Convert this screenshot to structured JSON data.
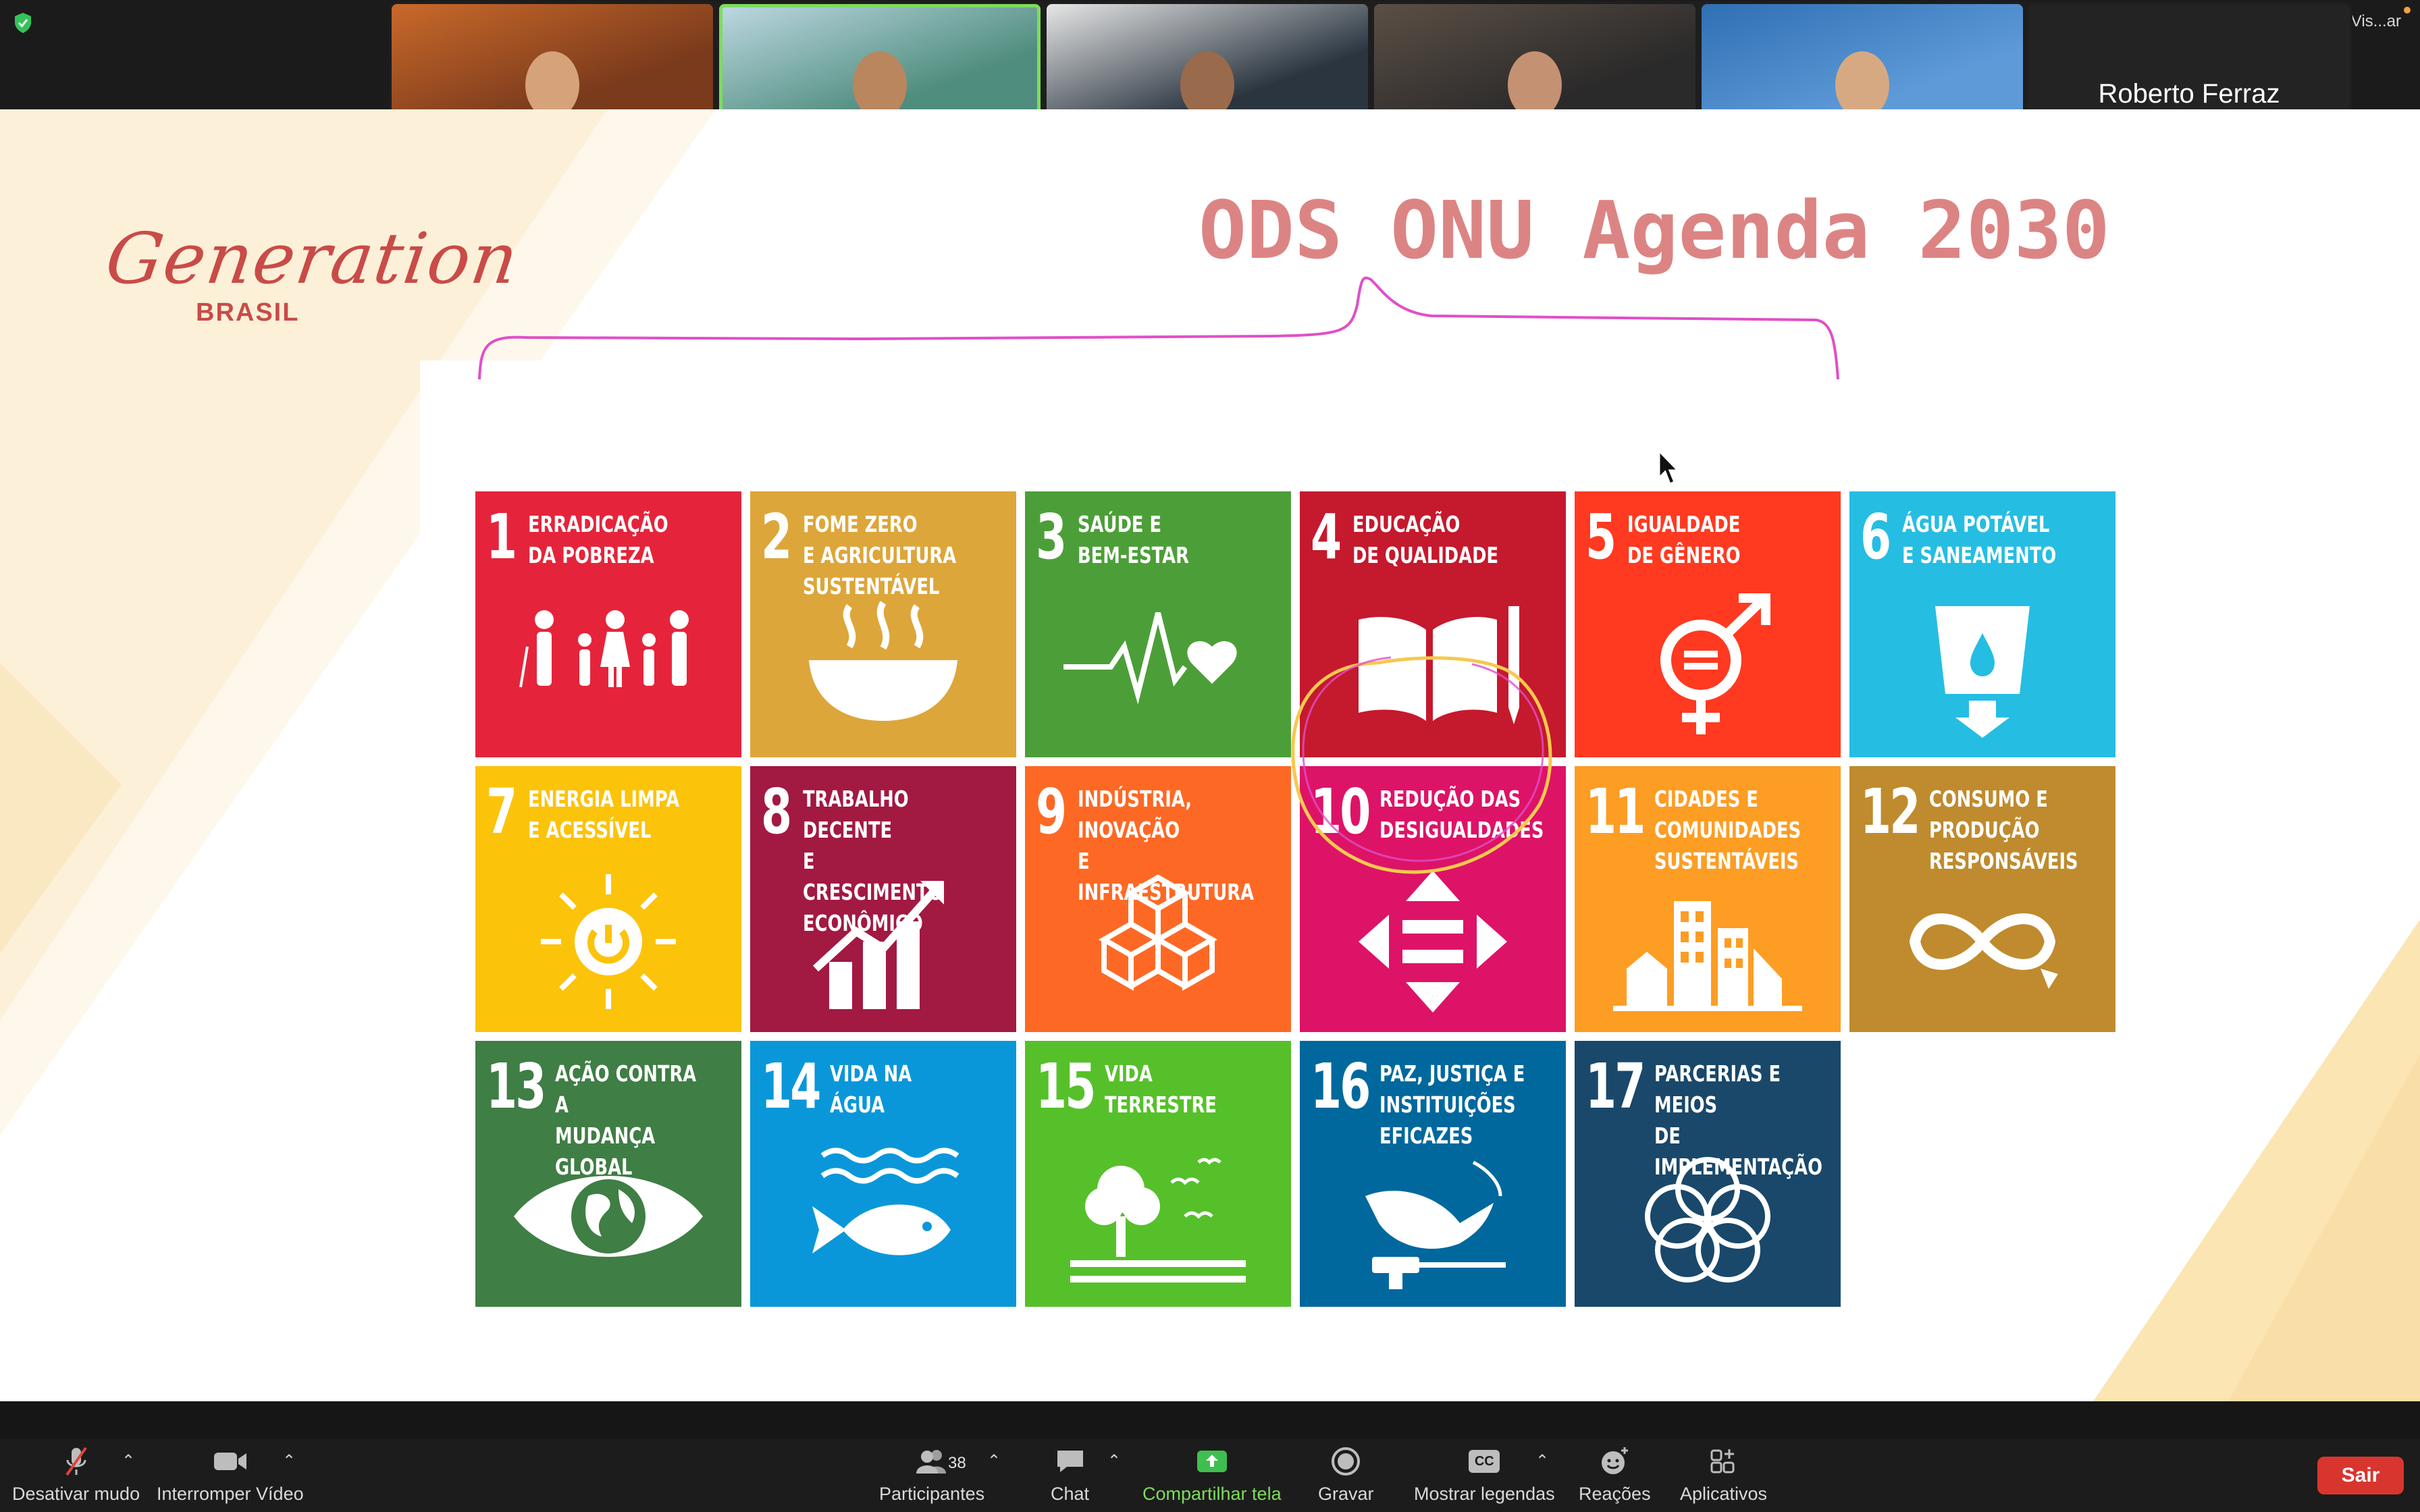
{
  "window": {
    "view_label": "Vis...ar"
  },
  "participants_gallery": [
    {
      "name": "",
      "bg": "#7a3a1c",
      "accent": "#c9692a",
      "skin": "#d6a27a",
      "shirt": "#2d4d7a"
    },
    {
      "name": "",
      "bg": "#4f8d7e",
      "accent": "#bfd9e3",
      "skin": "#b9865e",
      "shirt": "#3b3b3b"
    },
    {
      "name": "",
      "bg": "#2a3540",
      "accent": "#e6e6e6",
      "skin": "#9a6a4c",
      "shirt": "#1f1f1f"
    },
    {
      "name": "",
      "bg": "#2b2a2a",
      "accent": "#5b4f45",
      "skin": "#c49173",
      "shirt": "#2e2e2e"
    },
    {
      "name": "",
      "bg": "#5e9ad8",
      "accent": "#2f6fb3",
      "skin": "#d7a982",
      "shirt": "#222222"
    }
  ],
  "name_tile": "Roberto Ferraz",
  "slide": {
    "logo_word": "Generation",
    "logo_country": "BRASIL",
    "title": "ODS ONU Agenda 2030",
    "sdgs": [
      {
        "num": "1",
        "label": "Erradicação\nda pobreza",
        "color": "#e5243b",
        "icon": "family-icon"
      },
      {
        "num": "2",
        "label": "Fome zero\ne agricultura\nsustentável",
        "color": "#dda63a",
        "icon": "soup-bowl-icon"
      },
      {
        "num": "3",
        "label": "Saúde e\nbem-estar",
        "color": "#4c9f38",
        "icon": "heartbeat-icon"
      },
      {
        "num": "4",
        "label": "Educação\nde qualidade",
        "color": "#c5192d",
        "icon": "book-pencil-icon"
      },
      {
        "num": "5",
        "label": "Igualdade\nde gênero",
        "color": "#ff3a21",
        "icon": "gender-equality-icon"
      },
      {
        "num": "6",
        "label": "Água potável\ne saneamento",
        "color": "#26bde2",
        "icon": "water-glass-icon"
      },
      {
        "num": "7",
        "label": "Energia limpa\ne acessível",
        "color": "#fcc30b",
        "icon": "sun-power-icon"
      },
      {
        "num": "8",
        "label": "Trabalho decente\ne crescimento\neconômico",
        "color": "#a21942",
        "icon": "growth-chart-icon"
      },
      {
        "num": "9",
        "label": "Indústria, inovação\ne infraestrutura",
        "color": "#fd6925",
        "icon": "cubes-icon"
      },
      {
        "num": "10",
        "label": "Redução das\ndesigualdades",
        "color": "#dd1367",
        "icon": "arrows-equal-icon"
      },
      {
        "num": "11",
        "label": "Cidades e\ncomunidades\nsustentáveis",
        "color": "#fd9d24",
        "icon": "city-icon"
      },
      {
        "num": "12",
        "label": "Consumo e\nprodução\nresponsáveis",
        "color": "#bf8b2e",
        "icon": "infinity-icon"
      },
      {
        "num": "13",
        "label": "Ação contra a\nmudança global\ndo clima",
        "color": "#3f7e44",
        "icon": "earth-eye-icon"
      },
      {
        "num": "14",
        "label": "Vida na\nágua",
        "color": "#0a97d9",
        "icon": "fish-waves-icon"
      },
      {
        "num": "15",
        "label": "Vida\nterrestre",
        "color": "#56c02b",
        "icon": "tree-birds-icon"
      },
      {
        "num": "16",
        "label": "Paz, justiça e\ninstituições\neficazes",
        "color": "#00689d",
        "icon": "dove-gavel-icon"
      },
      {
        "num": "17",
        "label": "Parcerias e meios\nde implementação",
        "color": "#19486a",
        "icon": "rings-icon"
      }
    ]
  },
  "toolbar": {
    "mute_label": "Desativar mudo",
    "video_label": "Interromper Vídeo",
    "participants_label": "Participantes",
    "participants_count": "38",
    "chat_label": "Chat",
    "share_label": "Compartilhar tela",
    "record_label": "Gravar",
    "captions_label": "Mostrar legendas",
    "captions_badge": "CC",
    "reactions_label": "Reações",
    "apps_label": "Aplicativos",
    "leave_label": "Sair"
  },
  "colors": {
    "accent_green": "#7ddc5b",
    "leave_red": "#d8352f",
    "title_pink": "#dc8484",
    "annotation_magenta": "#e04fc8",
    "annotation_yellow": "#ffe45a"
  }
}
